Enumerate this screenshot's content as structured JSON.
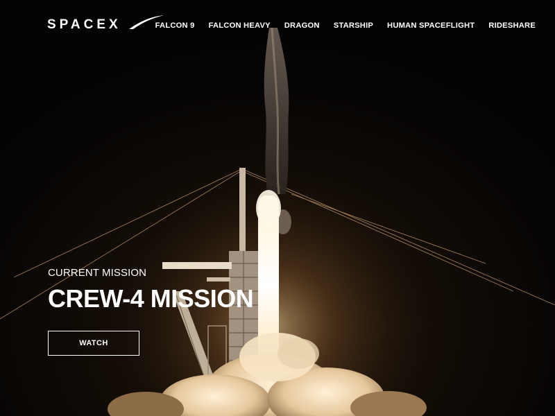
{
  "header": {
    "logo_text": "SPACEX"
  },
  "nav": {
    "items": [
      {
        "label": "FALCON 9"
      },
      {
        "label": "FALCON HEAVY"
      },
      {
        "label": "DRAGON"
      },
      {
        "label": "STARSHIP"
      },
      {
        "label": "HUMAN SPACEFLIGHT"
      },
      {
        "label": "RIDESHARE"
      }
    ]
  },
  "hero": {
    "kicker": "CURRENT MISSION",
    "title": "CREW-4 MISSION",
    "cta_label": "WATCH"
  },
  "colors": {
    "background": "#000000",
    "text": "#ffffff",
    "plume": "#fff6e0"
  },
  "icons": {
    "logo": "spacex-logo-swoosh"
  }
}
